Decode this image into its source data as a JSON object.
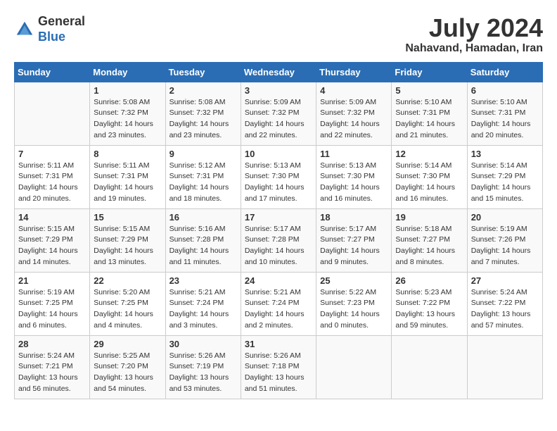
{
  "logo": {
    "general": "General",
    "blue": "Blue"
  },
  "title": "July 2024",
  "location": "Nahavand, Hamadan, Iran",
  "days_of_week": [
    "Sunday",
    "Monday",
    "Tuesday",
    "Wednesday",
    "Thursday",
    "Friday",
    "Saturday"
  ],
  "weeks": [
    [
      {
        "day": "",
        "sunrise": "",
        "sunset": "",
        "daylight": ""
      },
      {
        "day": "1",
        "sunrise": "Sunrise: 5:08 AM",
        "sunset": "Sunset: 7:32 PM",
        "daylight": "Daylight: 14 hours and 23 minutes."
      },
      {
        "day": "2",
        "sunrise": "Sunrise: 5:08 AM",
        "sunset": "Sunset: 7:32 PM",
        "daylight": "Daylight: 14 hours and 23 minutes."
      },
      {
        "day": "3",
        "sunrise": "Sunrise: 5:09 AM",
        "sunset": "Sunset: 7:32 PM",
        "daylight": "Daylight: 14 hours and 22 minutes."
      },
      {
        "day": "4",
        "sunrise": "Sunrise: 5:09 AM",
        "sunset": "Sunset: 7:32 PM",
        "daylight": "Daylight: 14 hours and 22 minutes."
      },
      {
        "day": "5",
        "sunrise": "Sunrise: 5:10 AM",
        "sunset": "Sunset: 7:31 PM",
        "daylight": "Daylight: 14 hours and 21 minutes."
      },
      {
        "day": "6",
        "sunrise": "Sunrise: 5:10 AM",
        "sunset": "Sunset: 7:31 PM",
        "daylight": "Daylight: 14 hours and 20 minutes."
      }
    ],
    [
      {
        "day": "7",
        "sunrise": "Sunrise: 5:11 AM",
        "sunset": "Sunset: 7:31 PM",
        "daylight": "Daylight: 14 hours and 20 minutes."
      },
      {
        "day": "8",
        "sunrise": "Sunrise: 5:11 AM",
        "sunset": "Sunset: 7:31 PM",
        "daylight": "Daylight: 14 hours and 19 minutes."
      },
      {
        "day": "9",
        "sunrise": "Sunrise: 5:12 AM",
        "sunset": "Sunset: 7:31 PM",
        "daylight": "Daylight: 14 hours and 18 minutes."
      },
      {
        "day": "10",
        "sunrise": "Sunrise: 5:13 AM",
        "sunset": "Sunset: 7:30 PM",
        "daylight": "Daylight: 14 hours and 17 minutes."
      },
      {
        "day": "11",
        "sunrise": "Sunrise: 5:13 AM",
        "sunset": "Sunset: 7:30 PM",
        "daylight": "Daylight: 14 hours and 16 minutes."
      },
      {
        "day": "12",
        "sunrise": "Sunrise: 5:14 AM",
        "sunset": "Sunset: 7:30 PM",
        "daylight": "Daylight: 14 hours and 16 minutes."
      },
      {
        "day": "13",
        "sunrise": "Sunrise: 5:14 AM",
        "sunset": "Sunset: 7:29 PM",
        "daylight": "Daylight: 14 hours and 15 minutes."
      }
    ],
    [
      {
        "day": "14",
        "sunrise": "Sunrise: 5:15 AM",
        "sunset": "Sunset: 7:29 PM",
        "daylight": "Daylight: 14 hours and 14 minutes."
      },
      {
        "day": "15",
        "sunrise": "Sunrise: 5:15 AM",
        "sunset": "Sunset: 7:29 PM",
        "daylight": "Daylight: 14 hours and 13 minutes."
      },
      {
        "day": "16",
        "sunrise": "Sunrise: 5:16 AM",
        "sunset": "Sunset: 7:28 PM",
        "daylight": "Daylight: 14 hours and 11 minutes."
      },
      {
        "day": "17",
        "sunrise": "Sunrise: 5:17 AM",
        "sunset": "Sunset: 7:28 PM",
        "daylight": "Daylight: 14 hours and 10 minutes."
      },
      {
        "day": "18",
        "sunrise": "Sunrise: 5:17 AM",
        "sunset": "Sunset: 7:27 PM",
        "daylight": "Daylight: 14 hours and 9 minutes."
      },
      {
        "day": "19",
        "sunrise": "Sunrise: 5:18 AM",
        "sunset": "Sunset: 7:27 PM",
        "daylight": "Daylight: 14 hours and 8 minutes."
      },
      {
        "day": "20",
        "sunrise": "Sunrise: 5:19 AM",
        "sunset": "Sunset: 7:26 PM",
        "daylight": "Daylight: 14 hours and 7 minutes."
      }
    ],
    [
      {
        "day": "21",
        "sunrise": "Sunrise: 5:19 AM",
        "sunset": "Sunset: 7:25 PM",
        "daylight": "Daylight: 14 hours and 6 minutes."
      },
      {
        "day": "22",
        "sunrise": "Sunrise: 5:20 AM",
        "sunset": "Sunset: 7:25 PM",
        "daylight": "Daylight: 14 hours and 4 minutes."
      },
      {
        "day": "23",
        "sunrise": "Sunrise: 5:21 AM",
        "sunset": "Sunset: 7:24 PM",
        "daylight": "Daylight: 14 hours and 3 minutes."
      },
      {
        "day": "24",
        "sunrise": "Sunrise: 5:21 AM",
        "sunset": "Sunset: 7:24 PM",
        "daylight": "Daylight: 14 hours and 2 minutes."
      },
      {
        "day": "25",
        "sunrise": "Sunrise: 5:22 AM",
        "sunset": "Sunset: 7:23 PM",
        "daylight": "Daylight: 14 hours and 0 minutes."
      },
      {
        "day": "26",
        "sunrise": "Sunrise: 5:23 AM",
        "sunset": "Sunset: 7:22 PM",
        "daylight": "Daylight: 13 hours and 59 minutes."
      },
      {
        "day": "27",
        "sunrise": "Sunrise: 5:24 AM",
        "sunset": "Sunset: 7:22 PM",
        "daylight": "Daylight: 13 hours and 57 minutes."
      }
    ],
    [
      {
        "day": "28",
        "sunrise": "Sunrise: 5:24 AM",
        "sunset": "Sunset: 7:21 PM",
        "daylight": "Daylight: 13 hours and 56 minutes."
      },
      {
        "day": "29",
        "sunrise": "Sunrise: 5:25 AM",
        "sunset": "Sunset: 7:20 PM",
        "daylight": "Daylight: 13 hours and 54 minutes."
      },
      {
        "day": "30",
        "sunrise": "Sunrise: 5:26 AM",
        "sunset": "Sunset: 7:19 PM",
        "daylight": "Daylight: 13 hours and 53 minutes."
      },
      {
        "day": "31",
        "sunrise": "Sunrise: 5:26 AM",
        "sunset": "Sunset: 7:18 PM",
        "daylight": "Daylight: 13 hours and 51 minutes."
      },
      {
        "day": "",
        "sunrise": "",
        "sunset": "",
        "daylight": ""
      },
      {
        "day": "",
        "sunrise": "",
        "sunset": "",
        "daylight": ""
      },
      {
        "day": "",
        "sunrise": "",
        "sunset": "",
        "daylight": ""
      }
    ]
  ]
}
